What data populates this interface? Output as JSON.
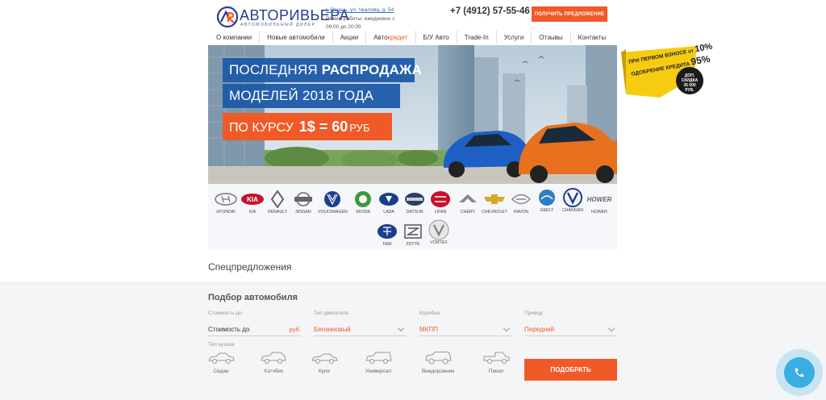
{
  "header": {
    "logo_part1": "АВТО",
    "logo_part2": "РИВЬЕРА",
    "logo_subtitle": "АВТОМОБИЛЬНЫЙ ДИЛЕР",
    "address": "г. Рязань, ул. Чкалова, д. 54",
    "hours": "Режим работы: ежедневно с 09:00 до 20:00",
    "phone": "+7 (4912) 57-55-46",
    "offer_button": "ПОЛУЧИТЬ ПРЕДЛОЖЕНИЕ"
  },
  "nav": {
    "items": [
      "О компании",
      "Новые автомобили",
      "Акции",
      "Авто",
      "Б/У Авто",
      "Trade-In",
      "Услуги",
      "Отзывы",
      "Контакты"
    ],
    "credit_suffix": "кредит"
  },
  "banner": {
    "line1_a": "ПОСЛЕДНЯЯ",
    "line1_b": "РАСПРОДАЖА",
    "line2": "МОДЕЛЕЙ 2018 ГОДА",
    "line3_a": "ПО КУРСУ",
    "line3_b": "1$ = 60",
    "line3_c": "РУБ",
    "accent_color": "#f05a28",
    "panel_color": "#1e5aa8"
  },
  "promo": {
    "line1": "ПРИ ПЕРВОМ ВЗНОСЕ от",
    "line1_value": "10%",
    "line2": "ОДОБРЕНИЕ КРЕДИТА",
    "line2_value": "95%",
    "badge": [
      "ДОП.",
      "СКИДКА",
      "35 000",
      "РУБ."
    ]
  },
  "brands": [
    {
      "name": "HYUNDAI",
      "icon": "hyundai-logo"
    },
    {
      "name": "KIA",
      "icon": "kia-logo"
    },
    {
      "name": "RENAULT",
      "icon": "renault-logo"
    },
    {
      "name": "NISSAN",
      "icon": "nissan-logo"
    },
    {
      "name": "VOLKSWAGEN",
      "icon": "volkswagen-logo"
    },
    {
      "name": "SKODA",
      "icon": "skoda-logo"
    },
    {
      "name": "LADA",
      "icon": "lada-logo"
    },
    {
      "name": "DATSUN",
      "icon": "datsun-logo"
    },
    {
      "name": "LIFAN",
      "icon": "lifan-logo"
    },
    {
      "name": "CHERY",
      "icon": "chery-logo"
    },
    {
      "name": "CHEVROLET",
      "icon": "chevrolet-logo"
    },
    {
      "name": "RAVON",
      "icon": "ravon-logo"
    },
    {
      "name": "GEELY",
      "icon": "geely-logo"
    },
    {
      "name": "CHANGAN",
      "icon": "changan-logo"
    },
    {
      "name": "HOWER",
      "icon": "hower-logo"
    },
    {
      "name": "FAW",
      "icon": "faw-logo"
    },
    {
      "name": "ZOTYE",
      "icon": "zotye-logo"
    },
    {
      "name": "VORTEX",
      "icon": "vortex-logo"
    }
  ],
  "special": {
    "title": "Спецпредложения"
  },
  "picker": {
    "title": "Подбор автомобиля",
    "price": {
      "label": "Стоимость до",
      "placeholder": "Стоимость до",
      "unit": "руб."
    },
    "engine": {
      "label": "Тип двигателя",
      "value": "Бензиновый"
    },
    "gearbox": {
      "label": "Коробка",
      "value": "МКПП"
    },
    "drive": {
      "label": "Привод",
      "value": "Передний"
    },
    "body_label": "Тип кузова",
    "body_types": [
      "Седан",
      "Хэтчбек",
      "Купе",
      "Универсал",
      "Внедорожник",
      "Пикап"
    ],
    "submit": "ПОДОБРАТЬ"
  },
  "colors": {
    "accent": "#f05a28",
    "call": "#3aaee2",
    "brand_text": "#2b3b8c"
  }
}
